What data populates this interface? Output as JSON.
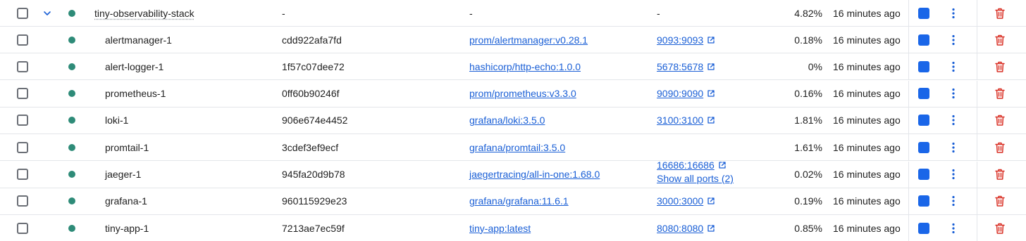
{
  "colors": {
    "status_running": "#2e8b78",
    "link": "#1a5fd6",
    "action_blue": "#1a66e8",
    "delete_red": "#d93025"
  },
  "icons": {
    "expand": "chevron-down-icon",
    "external": "external-link-icon",
    "more": "kebab-menu-icon",
    "delete": "trash-icon",
    "stop": "stop-icon"
  },
  "group": {
    "name": "tiny-observability-stack",
    "container_id": "-",
    "image": "-",
    "port": "-",
    "cpu": "4.82%",
    "last_started": "16 minutes ago"
  },
  "containers": [
    {
      "name": "alertmanager-1",
      "container_id": "cdd922afa7fd",
      "image": "prom/alertmanager:v0.28.1",
      "port": "9093:9093",
      "cpu": "0.18%",
      "last_started": "16 minutes ago"
    },
    {
      "name": "alert-logger-1",
      "container_id": "1f57c07dee72",
      "image": "hashicorp/http-echo:1.0.0",
      "port": "5678:5678",
      "cpu": "0%",
      "last_started": "16 minutes ago"
    },
    {
      "name": "prometheus-1",
      "container_id": "0ff60b90246f",
      "image": "prom/prometheus:v3.3.0",
      "port": "9090:9090",
      "cpu": "0.16%",
      "last_started": "16 minutes ago"
    },
    {
      "name": "loki-1",
      "container_id": "906e674e4452",
      "image": "grafana/loki:3.5.0",
      "port": "3100:3100",
      "cpu": "1.81%",
      "last_started": "16 minutes ago"
    },
    {
      "name": "promtail-1",
      "container_id": "3cdef3ef9ecf",
      "image": "grafana/promtail:3.5.0",
      "port": "",
      "cpu": "1.61%",
      "last_started": "16 minutes ago"
    },
    {
      "name": "jaeger-1",
      "container_id": "945fa20d9b78",
      "image": "jaegertracing/all-in-one:1.68.0",
      "port": "16686:16686",
      "port_more": "Show all ports (2)",
      "cpu": "0.02%",
      "last_started": "16 minutes ago"
    },
    {
      "name": "grafana-1",
      "container_id": "960115929e23",
      "image": "grafana/grafana:11.6.1",
      "port": "3000:3000",
      "cpu": "0.19%",
      "last_started": "16 minutes ago"
    },
    {
      "name": "tiny-app-1",
      "container_id": "7213ae7ec59f",
      "image": "tiny-app:latest",
      "port": "8080:8080",
      "cpu": "0.85%",
      "last_started": "16 minutes ago"
    }
  ]
}
